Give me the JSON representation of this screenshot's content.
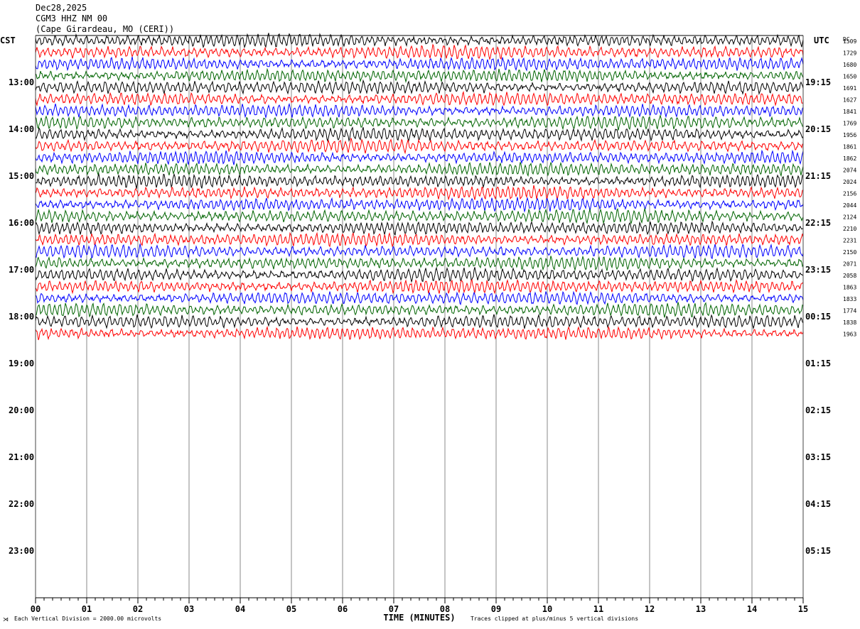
{
  "header": {
    "date": "Dec28,2025",
    "station": "CGM3 HHZ NM 00",
    "location": "(Cape Girardeau, MO (CERI))"
  },
  "left_tz": "CST",
  "right_tz": "UTC",
  "dc_label": "DC",
  "chart_data": {
    "type": "line",
    "title": "",
    "xlabel": "TIME (MINUTES)",
    "x_ticks": [
      "00",
      "01",
      "02",
      "03",
      "04",
      "05",
      "06",
      "07",
      "08",
      "09",
      "10",
      "11",
      "12",
      "13",
      "14",
      "15"
    ],
    "xlim": [
      0,
      15
    ],
    "left_hour_labels": [
      "13:00",
      "14:00",
      "15:00",
      "16:00",
      "17:00",
      "18:00",
      "19:00",
      "20:00",
      "21:00",
      "22:00",
      "23:00"
    ],
    "right_hour_labels": [
      "19:15",
      "20:15",
      "21:15",
      "22:15",
      "23:15",
      "00:15",
      "01:15",
      "02:15",
      "03:15",
      "04:15",
      "05:15"
    ],
    "trace_colors": [
      "#000000",
      "#ff0000",
      "#0000ff",
      "#006400"
    ],
    "dc_offsets": [
      "1509",
      "1729",
      "1680",
      "1650",
      "1691",
      "1627",
      "1841",
      "1769",
      "1956",
      "1861",
      "1862",
      "2074",
      "2024",
      "2156",
      "2044",
      "2124",
      "2210",
      "2231",
      "2150",
      "2071",
      "2058",
      "1863",
      "1833",
      "1774",
      "1838",
      "1963"
    ],
    "traces_recorded": 26,
    "minutes_per_trace": 15,
    "scale_note": "Each Vertical Division = 2000.00 microvolts",
    "clip_note": "Traces clipped at plus/minus 5 vertical divisions"
  }
}
